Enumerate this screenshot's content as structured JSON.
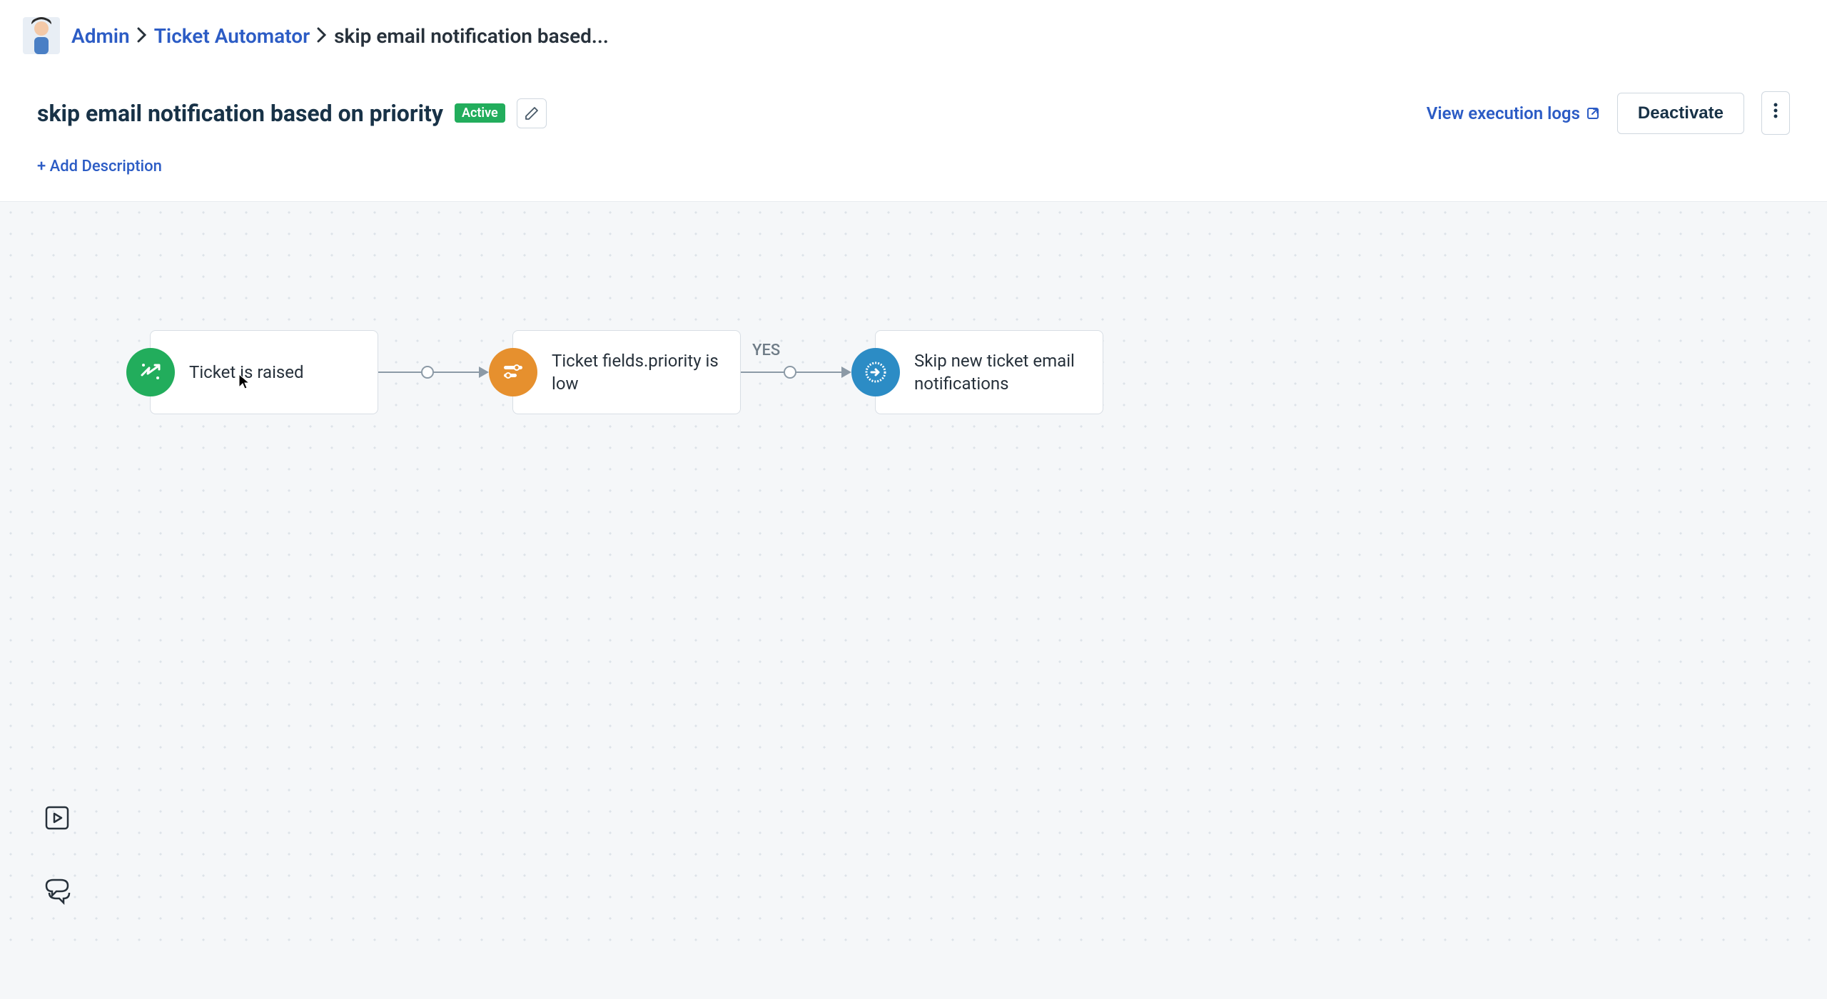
{
  "breadcrumbs": {
    "items": [
      {
        "label": "Admin",
        "link": true
      },
      {
        "label": "Ticket Automator",
        "link": true
      },
      {
        "label": "skip email notification based...",
        "link": false
      }
    ]
  },
  "page": {
    "title": "skip email notification based on priority",
    "status": "Active"
  },
  "actions": {
    "view_logs": "View execution logs",
    "deactivate": "Deactivate",
    "add_description": "+ Add Description"
  },
  "flow": {
    "nodes": [
      {
        "label": "Ticket is raised",
        "type": "trigger"
      },
      {
        "label": "Ticket fields.priority is low",
        "type": "condition"
      },
      {
        "label": "Skip new ticket email notifications",
        "type": "action"
      }
    ],
    "connectors": [
      {
        "label": ""
      },
      {
        "label": "YES"
      }
    ]
  }
}
